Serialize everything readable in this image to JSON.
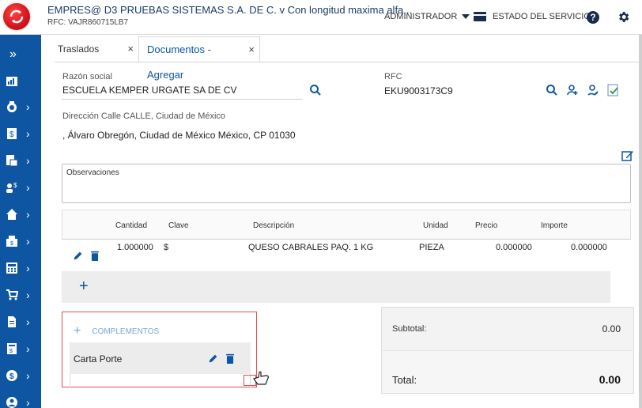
{
  "header": {
    "company_title": "EMPRES@ D3 PRUEBAS SISTEMAS S.A. DE C. v Con longitud maxima alfa...",
    "rfc_line": "RFC: VAJR860715LB7",
    "admin_label": "ADMINISTRADOR",
    "status_label": "ESTADO DEL SERVICIO",
    "help_glyph": "?"
  },
  "tabs": [
    {
      "label": "Traslados",
      "close": "×"
    },
    {
      "label": "Documentos - Agregar",
      "close": "×"
    }
  ],
  "form": {
    "razon_social_label": "Razón social",
    "razon_social_value": "ESCUELA KEMPER URGATE SA DE CV",
    "rfc_label": "RFC",
    "rfc_value": "EKU9003173C9",
    "direccion_label": "Dirección Calle CALLE, Ciudad de México",
    "direccion_value": ", Álvaro Obregón, Ciudad de México México, CP 01030",
    "observaciones_label": "Observaciones"
  },
  "table": {
    "headers": [
      "Cantidad",
      "Clave",
      "Descripción",
      "Unidad",
      "Precio",
      "Importe"
    ],
    "rows": [
      {
        "cantidad": "1.000000",
        "clave": "$",
        "descripcion": "QUESO CABRALES PAQ. 1 KG",
        "unidad": "PIEZA",
        "precio": "0.000000",
        "importe": "0.000000"
      }
    ],
    "add_glyph": "+"
  },
  "complements": {
    "header": "COMPLEMENTOS",
    "add_glyph": "+",
    "items": [
      {
        "label": "Carta Porte"
      }
    ]
  },
  "totals": {
    "subtotal_label": "Subtotal:",
    "subtotal_value": "0.00",
    "total_label": "Total:",
    "total_value": "0.00"
  },
  "sidebar": {
    "expand_glyph": "»",
    "items": [
      {
        "icon": "dashboard-icon",
        "chevron": false
      },
      {
        "icon": "coins-icon",
        "chevron": true
      },
      {
        "icon": "invoice-icon",
        "chevron": true
      },
      {
        "icon": "documents-icon",
        "chevron": true
      },
      {
        "icon": "people-money-icon",
        "chevron": true
      },
      {
        "icon": "home-icon",
        "chevron": true
      },
      {
        "icon": "cash-register-icon",
        "chevron": true
      },
      {
        "icon": "calculator-icon",
        "chevron": true
      },
      {
        "icon": "cart-icon",
        "chevron": true
      },
      {
        "icon": "file-icon",
        "chevron": true
      },
      {
        "icon": "report-icon",
        "chevron": true
      },
      {
        "icon": "dollar-icon",
        "chevron": true
      },
      {
        "icon": "user-icon",
        "chevron": true
      }
    ]
  },
  "colors": {
    "brand_blue": "#0e56a1",
    "dark_navy": "#1a2b4c",
    "highlight_red": "#e05050"
  }
}
